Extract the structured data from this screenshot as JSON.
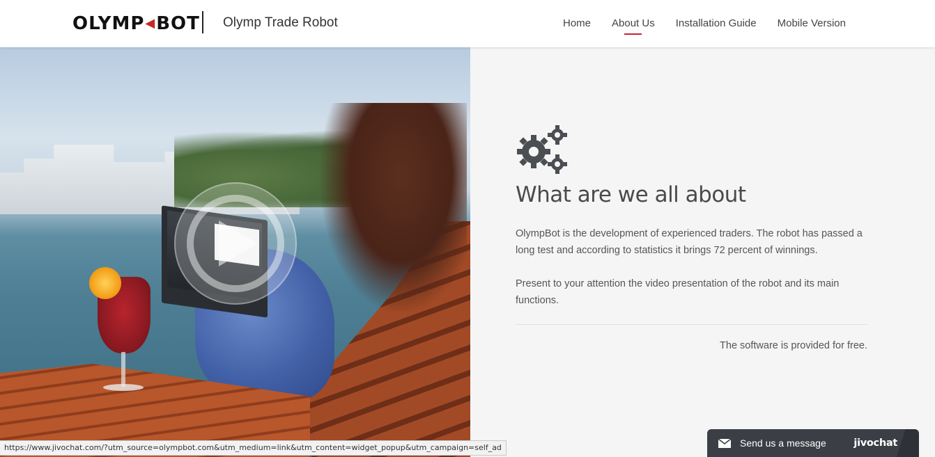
{
  "header": {
    "logo_left": "OLYMP",
    "logo_right": "BOT",
    "tagline": "Olymp Trade Robot",
    "nav": [
      {
        "label": "Home",
        "active": false
      },
      {
        "label": "About Us",
        "active": true
      },
      {
        "label": "Installation Guide",
        "active": false
      },
      {
        "label": "Mobile Version",
        "active": false
      }
    ]
  },
  "hero": {
    "icon": "play-icon"
  },
  "about": {
    "icon": "gears-icon",
    "title": "What are we all about",
    "paragraph_1": "OlympBot is the development of experienced traders. The robot has passed a long test and according to statistics it brings 72 percent of winnings.",
    "paragraph_2": "Present to your attention the video presentation of the robot and its main functions.",
    "free_note": "The software is provided for free."
  },
  "status_bar": {
    "url": "https://www.jivochat.com/?utm_source=olympbot.com&utm_medium=link&utm_content=widget_popup&utm_campaign=self_ad"
  },
  "chat_widget": {
    "label": "Send us a message",
    "brand": "jivochat",
    "icon": "mail-icon"
  },
  "colors": {
    "accent": "#c2223a",
    "logo_mark": "#c62828",
    "chat_bg": "#3b3f45",
    "panel_bg": "#f5f5f5"
  }
}
